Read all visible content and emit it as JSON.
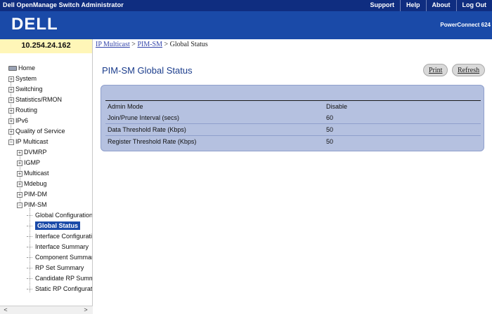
{
  "topbar": {
    "title": "Dell OpenManage Switch Administrator",
    "links": [
      "Support",
      "Help",
      "About",
      "Log Out"
    ]
  },
  "banner": {
    "logo": "DELL",
    "product": "PowerConnect 624"
  },
  "ip_address": "10.254.24.162",
  "breadcrumb": {
    "parts": [
      "IP Multicast",
      "PIM-SM",
      "Global Status"
    ],
    "sep": " > "
  },
  "sidebar": {
    "items": [
      {
        "label": "Home",
        "level": 0,
        "icon": "home-icon"
      },
      {
        "label": "System",
        "level": 0,
        "icon": "plus-icon"
      },
      {
        "label": "Switching",
        "level": 0,
        "icon": "plus-icon"
      },
      {
        "label": "Statistics/RMON",
        "level": 0,
        "icon": "plus-icon"
      },
      {
        "label": "Routing",
        "level": 0,
        "icon": "plus-icon"
      },
      {
        "label": "IPv6",
        "level": 0,
        "icon": "plus-icon"
      },
      {
        "label": "Quality of Service",
        "level": 0,
        "icon": "plus-icon"
      },
      {
        "label": "IP Multicast",
        "level": 0,
        "icon": "minus-icon"
      },
      {
        "label": "DVMRP",
        "level": 1,
        "icon": "plus-icon"
      },
      {
        "label": "IGMP",
        "level": 1,
        "icon": "plus-icon"
      },
      {
        "label": "Multicast",
        "level": 1,
        "icon": "plus-icon"
      },
      {
        "label": "Mdebug",
        "level": 1,
        "icon": "plus-icon"
      },
      {
        "label": "PIM-DM",
        "level": 1,
        "icon": "plus-icon"
      },
      {
        "label": "PIM-SM",
        "level": 1,
        "icon": "minus-icon"
      },
      {
        "label": "Global Configuration",
        "level": 2,
        "icon": "leaf"
      },
      {
        "label": "Global Status",
        "level": 2,
        "icon": "leaf",
        "selected": true
      },
      {
        "label": "Interface Configuration",
        "level": 2,
        "icon": "leaf"
      },
      {
        "label": "Interface Summary",
        "level": 2,
        "icon": "leaf"
      },
      {
        "label": "Component Summary",
        "level": 2,
        "icon": "leaf"
      },
      {
        "label": "RP Set Summary",
        "level": 2,
        "icon": "leaf"
      },
      {
        "label": "Candidate RP Summary",
        "level": 2,
        "icon": "leaf"
      },
      {
        "label": "Static RP Configuration",
        "level": 2,
        "icon": "leaf"
      }
    ]
  },
  "page": {
    "title": "PIM-SM Global Status",
    "print_label": "Print",
    "refresh_label": "Refresh"
  },
  "status_table": {
    "rows": [
      {
        "label": "Admin Mode",
        "value": "Disable"
      },
      {
        "label": "Join/Prune Interval (secs)",
        "value": "60"
      },
      {
        "label": "Data Threshold Rate (Kbps)",
        "value": "50"
      },
      {
        "label": "Register Threshold Rate (Kbps)",
        "value": "50"
      }
    ]
  },
  "colors": {
    "topbar": "#0f2d80",
    "banner": "#1a4aa8",
    "ip_band": "#fff6b8",
    "panel": "#b5c1e0",
    "selected": "#1a4aa8"
  }
}
